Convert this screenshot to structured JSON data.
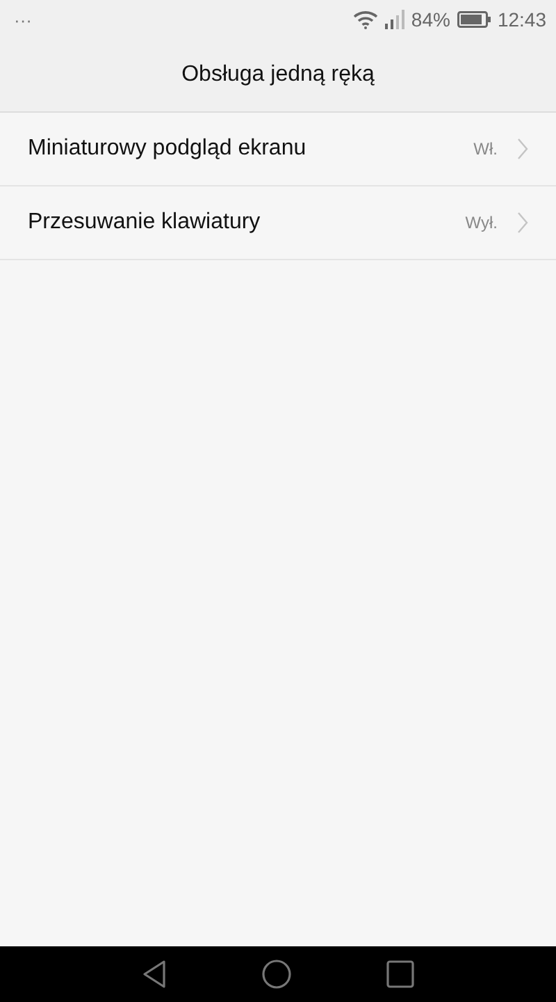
{
  "status_bar": {
    "notifications": "···",
    "battery_percent": "84%",
    "time": "12:43"
  },
  "header": {
    "title": "Obsługa jedną ręką"
  },
  "settings": [
    {
      "label": "Miniaturowy podgląd ekranu",
      "value": "Wł."
    },
    {
      "label": "Przesuwanie klawiatury",
      "value": "Wył."
    }
  ]
}
